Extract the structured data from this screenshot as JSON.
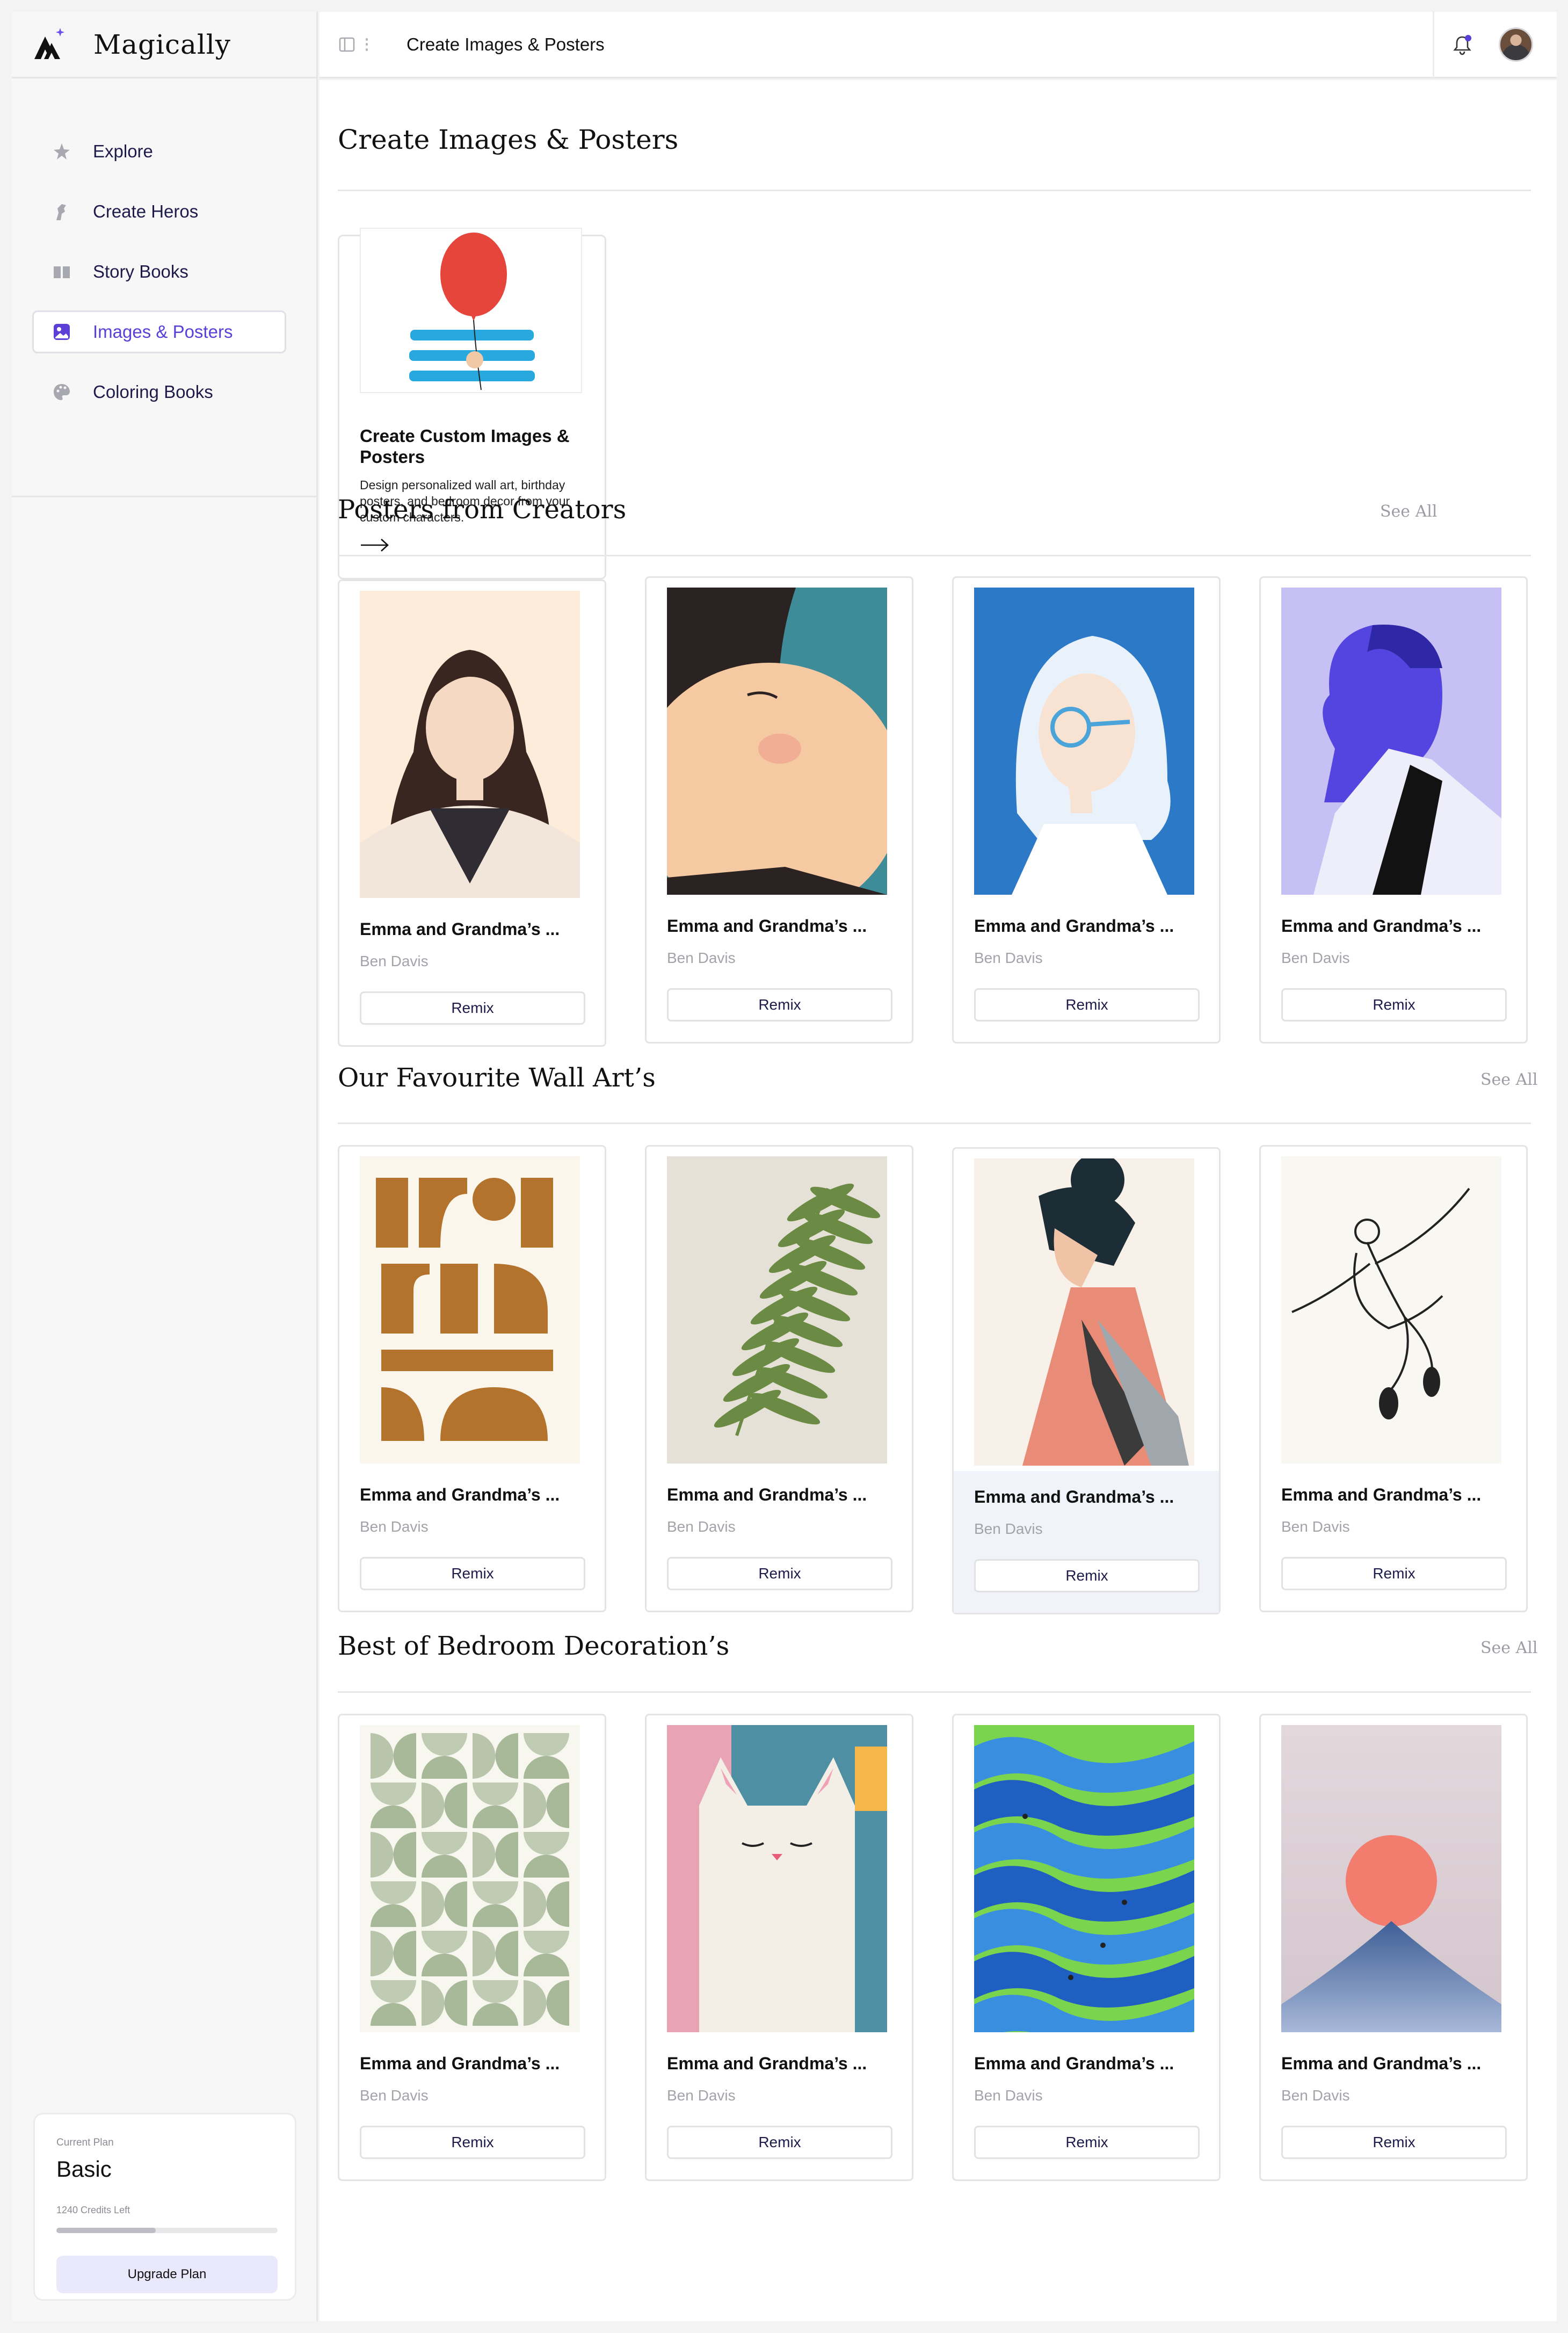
{
  "brand": {
    "name": "Magically"
  },
  "sidebar": {
    "items": [
      {
        "label": "Explore",
        "icon": "star-icon",
        "active": false
      },
      {
        "label": "Create Heros",
        "icon": "hero-icon",
        "active": false
      },
      {
        "label": "Story Books",
        "icon": "book-icon",
        "active": false
      },
      {
        "label": "Images & Posters",
        "icon": "image-icon",
        "active": true
      },
      {
        "label": "Coloring Books",
        "icon": "palette-icon",
        "active": false
      }
    ],
    "plan": {
      "caption": "Current Plan",
      "name": "Basic",
      "credits": "1240 Credits Left",
      "progress": 0.45,
      "upgrade_label": "Upgrade Plan"
    }
  },
  "topbar": {
    "title": "Create Images & Posters"
  },
  "main": {
    "title": "Create Images & Posters",
    "create_card": {
      "title": "Create Custom Images & Posters",
      "description": "Design personalized wall art, birthday posters, and bedroom decor from your custom characters."
    },
    "sections": [
      {
        "title": "Posters from Creators",
        "see_all": "See All",
        "cards": [
          {
            "title": "Emma and Grandma’s ...",
            "author": "Ben Davis",
            "button": "Remix",
            "art": "portrait-woman-dark-hair"
          },
          {
            "title": "Emma and Grandma’s ...",
            "author": "Ben Davis",
            "button": "Remix",
            "art": "portrait-child-closeup"
          },
          {
            "title": "Emma and Grandma’s ...",
            "author": "Ben Davis",
            "button": "Remix",
            "art": "portrait-white-hair-glasses"
          },
          {
            "title": "Emma and Grandma’s ...",
            "author": "Ben Davis",
            "button": "Remix",
            "art": "portrait-purple-profile"
          }
        ]
      },
      {
        "title": "Our Favourite Wall Art’s",
        "see_all": "See All",
        "cards": [
          {
            "title": "Emma and Grandma’s ...",
            "author": "Ben Davis",
            "button": "Remix",
            "art": "abstract-ochre-shapes"
          },
          {
            "title": "Emma and Grandma’s ...",
            "author": "Ben Davis",
            "button": "Remix",
            "art": "green-fern-leaf"
          },
          {
            "title": "Emma and Grandma’s ...",
            "author": "Ben Davis",
            "button": "Remix",
            "art": "woman-profile-bun"
          },
          {
            "title": "Emma and Grandma’s ...",
            "author": "Ben Davis",
            "button": "Remix",
            "art": "line-art-dancer"
          }
        ]
      },
      {
        "title": "Best of Bedroom Decoration’s",
        "see_all": "See All",
        "cards": [
          {
            "title": "Emma and Grandma’s ...",
            "author": "Ben Davis",
            "button": "Remix",
            "art": "sage-semicircle-pattern"
          },
          {
            "title": "Emma and Grandma’s ...",
            "author": "Ben Davis",
            "button": "Remix",
            "art": "painted-white-cat"
          },
          {
            "title": "Emma and Grandma’s ...",
            "author": "Ben Davis",
            "button": "Remix",
            "art": "green-blue-hills-cyclists"
          },
          {
            "title": "Emma and Grandma’s ...",
            "author": "Ben Davis",
            "button": "Remix",
            "art": "pink-sun-mountain"
          }
        ]
      }
    ]
  },
  "colors": {
    "accent": "#5b3fd6",
    "button_text": "#1e1b4b",
    "muted_text": "#a3a3aa"
  }
}
